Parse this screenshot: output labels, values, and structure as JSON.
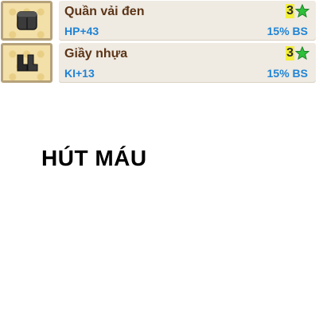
{
  "items": [
    {
      "name": "Quần vải đen",
      "stat": "HP+43",
      "stars": "3",
      "bs": "15% BS",
      "icon": "black-pants-icon"
    },
    {
      "name": "Giầy nhựa",
      "stat": "KI+13",
      "stars": "3",
      "bs": "15% BS",
      "icon": "black-boots-icon"
    }
  ],
  "heading": "HÚT MÁU",
  "colors": {
    "name": "#5b3417",
    "stat": "#1f84d6",
    "star": "#2fbf3a",
    "slot": "#f3e0a8"
  }
}
